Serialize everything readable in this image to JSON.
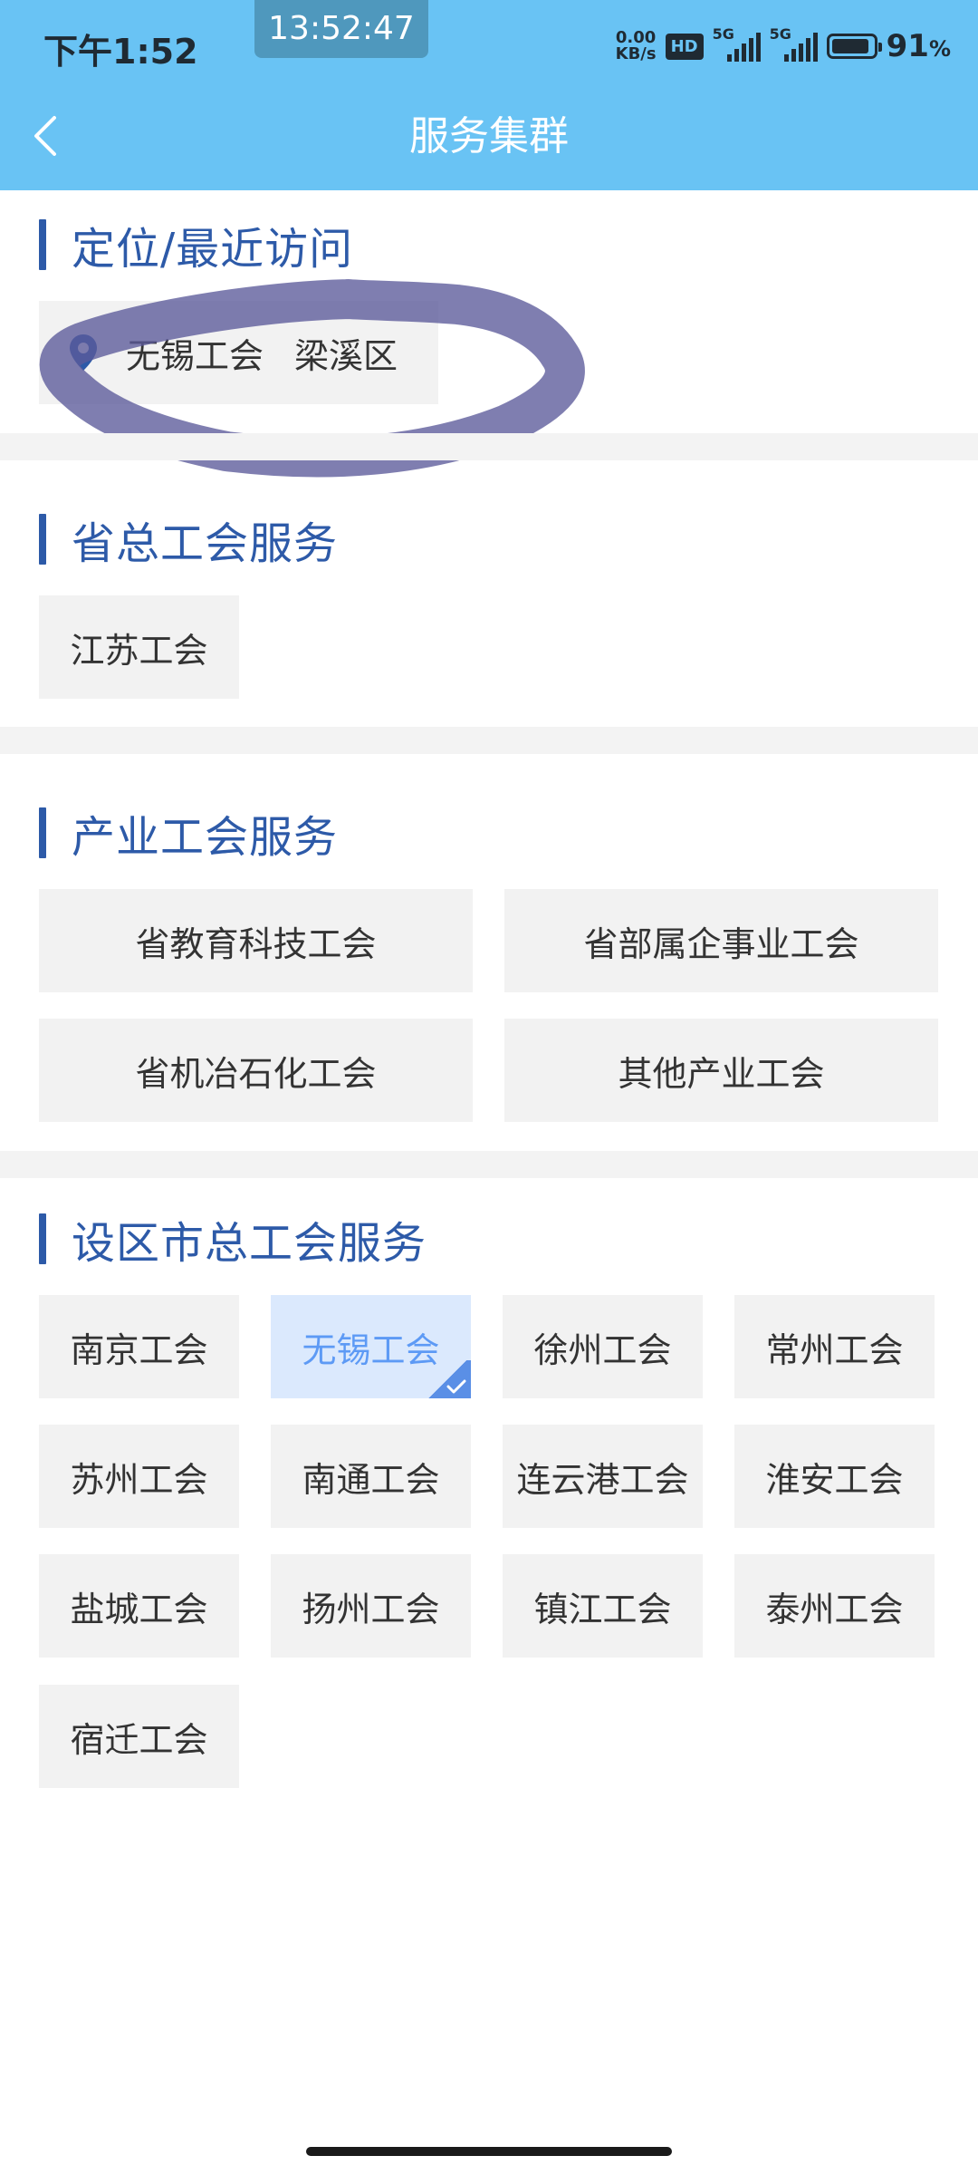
{
  "status_bar": {
    "time": "下午1:52",
    "clock": "13:52:47",
    "speed_value": "0.00",
    "speed_unit": "KB/s",
    "hd": "HD",
    "network_1": "5G",
    "network_2": "5G",
    "battery_percent": "91",
    "battery_unit": "%",
    "battery_level": 0.91
  },
  "header": {
    "title": "服务集群",
    "back_icon": "chevron-left-icon",
    "bg_color": "#69c3f4"
  },
  "sections": {
    "recent": {
      "title": "定位/最近访问",
      "location": {
        "icon": "location-pin-icon",
        "name": "无锡工会",
        "district": "梁溪区"
      }
    },
    "provincial": {
      "title": "省总工会服务",
      "items": [
        "江苏工会"
      ]
    },
    "industry": {
      "title": "产业工会服务",
      "items": [
        "省教育科技工会",
        "省部属企事业工会",
        "省机冶石化工会",
        "其他产业工会"
      ]
    },
    "city": {
      "title": "设区市总工会服务",
      "items": [
        "南京工会",
        "无锡工会",
        "徐州工会",
        "常州工会",
        "苏州工会",
        "南通工会",
        "连云港工会",
        "淮安工会",
        "盐城工会",
        "扬州工会",
        "镇江工会",
        "泰州工会",
        "宿迁工会"
      ],
      "selected": "无锡工会"
    }
  },
  "colors": {
    "accent": "#2d5aa8",
    "selected_bg": "#dbe9fd",
    "selected_text": "#5d9af5",
    "chip_bg": "#f2f2f2"
  }
}
